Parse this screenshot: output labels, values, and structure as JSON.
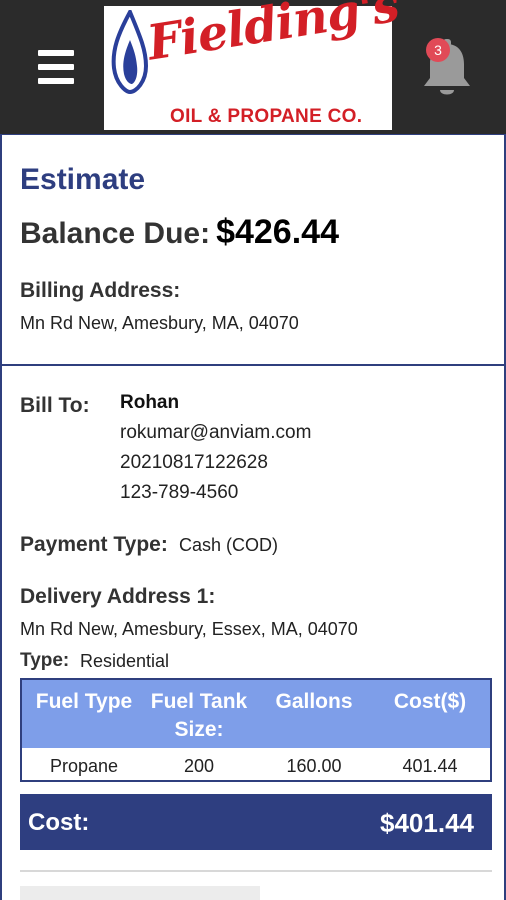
{
  "header": {
    "logo_name": "Fielding's",
    "logo_sub": "OIL & PROPANE CO.",
    "notification_count": "3",
    "icons": {
      "menu": "hamburger-menu-icon",
      "bell": "bell-icon",
      "flame": "flame-icon"
    },
    "colors": {
      "bar": "#2b2b2b",
      "logo_red": "#d31f26",
      "flame_blue": "#2a3f9a",
      "badge": "#e14a57"
    }
  },
  "estimate": {
    "title": "Estimate",
    "balance_label": "Balance Due:",
    "balance_amount": "$426.44",
    "billing_label": "Billing Address:",
    "billing_address": "Mn Rd New, Amesbury, MA, 04070"
  },
  "bill_to": {
    "label": "Bill To:",
    "name": "Rohan",
    "email": "rokumar@anviam.com",
    "id": "20210817122628",
    "phone": "123-789-4560"
  },
  "payment": {
    "label": "Payment Type:",
    "value": "Cash (COD)"
  },
  "delivery": {
    "label": "Delivery Address 1:",
    "address": "Mn Rd New, Amesbury, Essex, MA, 04070",
    "type_label": "Type:",
    "type_value": "Residential"
  },
  "fuel_table": {
    "headers": [
      "Fuel Type",
      "Fuel Tank Size:",
      "Gallons",
      "Cost($)"
    ],
    "header_lines": [
      [
        "Fuel Type"
      ],
      [
        "Fuel Tank",
        "Size:"
      ],
      [
        "Gallons"
      ],
      [
        "Cost($)"
      ]
    ],
    "rows": [
      [
        "Propane",
        "200",
        "160.00",
        "401.44"
      ]
    ],
    "colors": {
      "header_bg": "#7e9ee9",
      "border": "#2f3f7e"
    }
  },
  "cost_summary": {
    "label": "Cost:",
    "value": "$401.44",
    "color": "#2e3e80"
  }
}
